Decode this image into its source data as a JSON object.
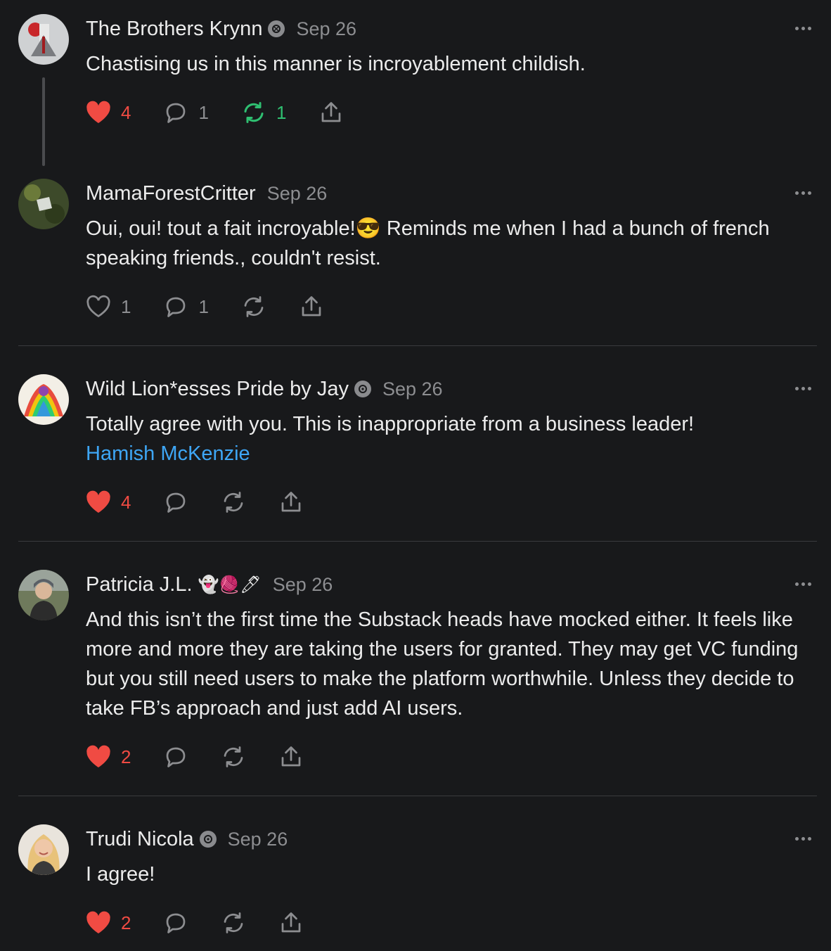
{
  "comments": [
    {
      "author": "The Brothers Krynn",
      "date": "Sep 26",
      "text": "Chastising us in this manner is incroyablement childish.",
      "likes": "4",
      "replies": "1",
      "restacks": "1",
      "liked": true,
      "restacked": true
    },
    {
      "author": "MamaForestCritter",
      "date": "Sep 26",
      "text": "Oui, oui! tout a fait incroyable!😎 Reminds me when I had a bunch of french speaking friends., couldn't resist.",
      "likes": "1",
      "replies": "1",
      "liked": false
    },
    {
      "author": "Wild Lion*esses Pride by Jay",
      "date": "Sep 26",
      "text": "Totally agree with you. This is inappropriate from a business leader!",
      "mention": "Hamish McKenzie",
      "likes": "4",
      "liked": true
    },
    {
      "author": "Patricia J.L.",
      "author_emojis": "👻🧶🖊",
      "date": "Sep 26",
      "text": "And this isn’t the first time the Substack heads have mocked either. It feels like more and more they are taking the users for granted. They may get VC funding but you still need users to make the platform worthwhile. Unless they decide to take FB’s approach and just add AI users.",
      "likes": "2",
      "liked": true
    },
    {
      "author": "Trudi Nicola",
      "date": "Sep 26",
      "text": "I agree!",
      "likes": "2",
      "liked": true
    }
  ],
  "colors": {
    "background": "#18191b",
    "like_red": "#f04b43",
    "restack_green": "#2fbf71",
    "mention_blue": "#3ea6f5",
    "muted": "#8d8e91"
  },
  "icons": [
    "heart-icon",
    "comment-icon",
    "restack-icon",
    "share-icon",
    "more-icon",
    "badge-icon"
  ]
}
